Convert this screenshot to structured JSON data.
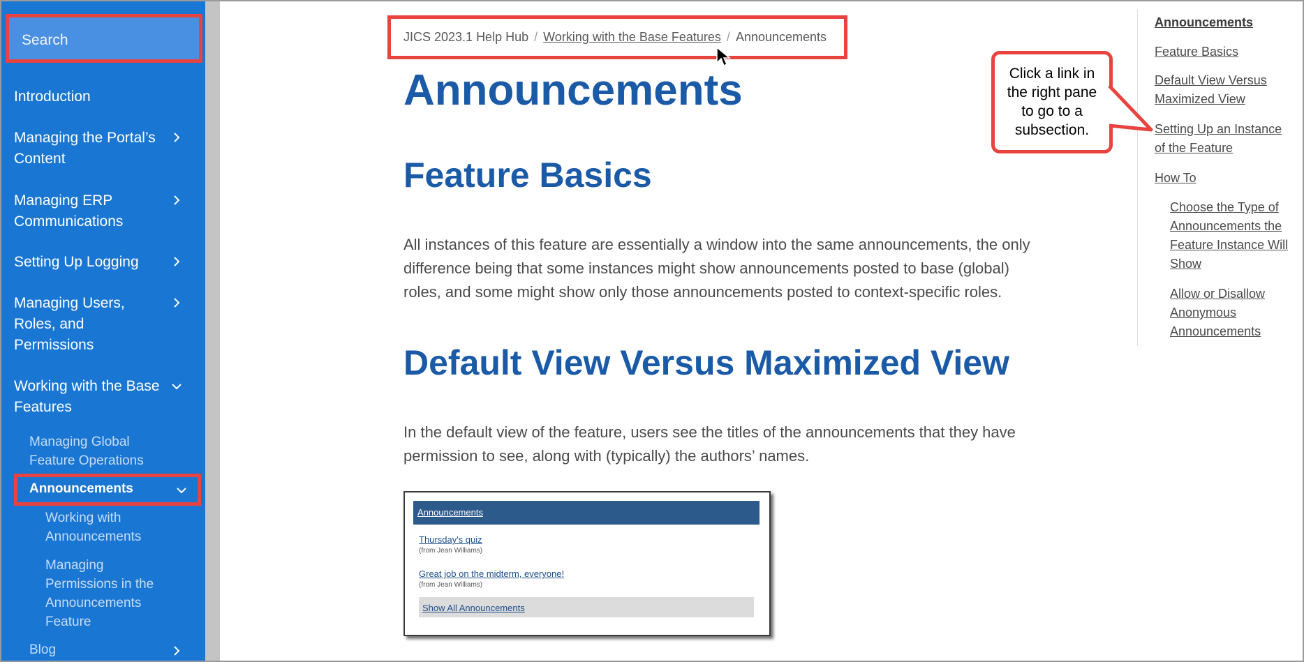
{
  "sidebar": {
    "search_placeholder": "Search",
    "items": [
      {
        "label": "Introduction"
      },
      {
        "label_lines": [
          "Managing the Portal’s",
          "Content"
        ]
      },
      {
        "label_lines": [
          "Managing ERP",
          "Communications"
        ]
      },
      {
        "label": "Setting Up Logging"
      },
      {
        "label_lines": [
          "Managing Users,",
          "Roles, and",
          "Permissions"
        ]
      },
      {
        "label_lines": [
          "Working with the Base",
          "Features"
        ]
      }
    ],
    "sub_items": [
      {
        "label_lines": [
          "Managing Global",
          "Feature Operations"
        ]
      },
      {
        "label": "Announcements"
      }
    ],
    "sub_sub_items": [
      {
        "label_lines": [
          "Working with",
          "Announcements"
        ]
      },
      {
        "label_lines": [
          "Managing",
          "Permissions in the",
          "Announcements",
          "Feature"
        ]
      }
    ],
    "blog": "Blog"
  },
  "breadcrumb": {
    "root": "JICS 2023.1 Help Hub",
    "parent": "Working with the Base Features",
    "current": "Announcements",
    "separator": "/"
  },
  "content": {
    "title": "Announcements",
    "section1": {
      "heading": "Feature Basics",
      "lines": [
        "All instances of this feature are essentially a window into the same announcements, the only",
        "difference being that some instances might show announcements posted to base (global)",
        "roles, and some might show only those announcements posted to context-specific roles."
      ]
    },
    "section2": {
      "heading": "Default View Versus Maximized View",
      "lines": [
        "In the default view of the feature, users see the titles of the announcements that they have",
        "permission to see, along with (typically) the authors’ names."
      ]
    }
  },
  "widget": {
    "header": "Announcements",
    "items": [
      {
        "title": "Thursday's quiz",
        "author": "(from Jean Williams)"
      },
      {
        "title": "Great job on the midterm, everyone!",
        "author": "(from Jean Williams)"
      }
    ],
    "footer_link": "Show All Announcements"
  },
  "callout": {
    "lines": [
      "Click a link in",
      "the right pane",
      "to go to a",
      "subsection."
    ]
  },
  "toc": {
    "items": [
      {
        "label_lines": [
          "Announcements"
        ]
      },
      {
        "label_lines": [
          "Feature Basics"
        ]
      },
      {
        "label_lines": [
          "Default View Versus",
          "Maximized View"
        ]
      },
      {
        "label_lines": [
          "Setting Up an Instance",
          "of the Feature"
        ]
      },
      {
        "label_lines": [
          "How To"
        ]
      },
      {
        "label_lines": [
          "Choose the Type of",
          "Announcements the",
          "Feature Instance Will",
          "Show"
        ]
      },
      {
        "label_lines": [
          "Allow or Disallow",
          "Anonymous",
          "Announcements"
        ]
      }
    ]
  },
  "colors": {
    "sidebar": "#1976d2",
    "highlight_border": "#e8433f",
    "heading": "#1a5aa6"
  }
}
